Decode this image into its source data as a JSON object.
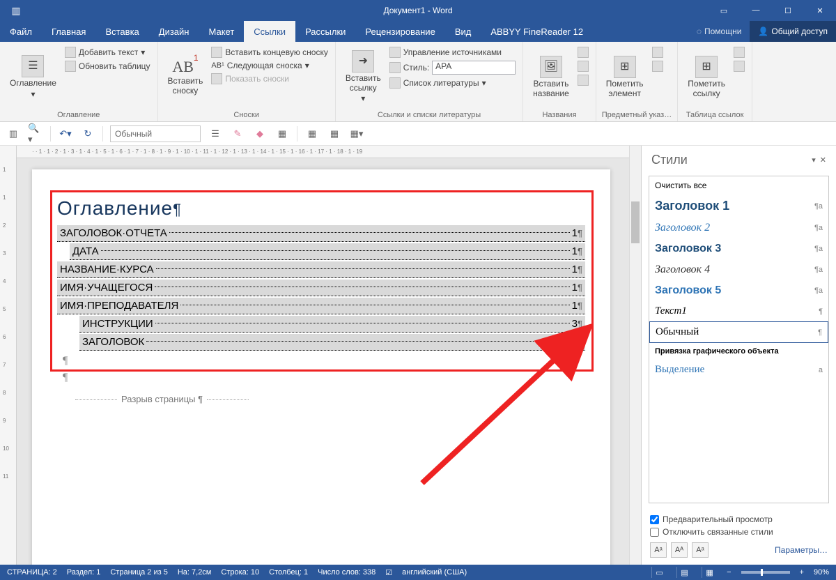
{
  "title": "Документ1 - Word",
  "menu": {
    "file": "Файл",
    "home": "Главная",
    "insert": "Вставка",
    "design": "Дизайн",
    "layout": "Макет",
    "references": "Ссылки",
    "mailings": "Рассылки",
    "review": "Рецензирование",
    "view": "Вид",
    "addin": "ABBYY FineReader 12",
    "tell": "Помощни",
    "share": "Общий доступ"
  },
  "ribbon": {
    "toc": {
      "title": "Оглавление",
      "main": "Оглавление",
      "add": "Добавить текст",
      "update": "Обновить таблицу"
    },
    "footnotes": {
      "title": "Сноски",
      "insert": "Вставить\nсноску",
      "endnote": "Вставить концевую сноску",
      "next": "Следующая сноска",
      "show": "Показать сноски"
    },
    "citations": {
      "title": "Ссылки и списки литературы",
      "insert": "Вставить\nссылку",
      "manage": "Управление источниками",
      "style_label": "Стиль:",
      "style_value": "APA",
      "biblio": "Список литературы"
    },
    "captions": {
      "title": "Названия",
      "insert": "Вставить\nназвание"
    },
    "index": {
      "title": "Предметный указ…",
      "mark": "Пометить\nэлемент"
    },
    "authorities": {
      "title": "Таблица ссылок",
      "mark": "Пометить\nссылку"
    }
  },
  "quick_style": "Обычный",
  "document": {
    "toc_title": "Оглавление",
    "entries": [
      {
        "label": "ЗАГОЛОВОК·ОТЧЕТА",
        "page": "1",
        "indent": 0
      },
      {
        "label": "ДАТА",
        "page": "1",
        "indent": 1
      },
      {
        "label": "НАЗВАНИЕ·КУРСА",
        "page": "1",
        "indent": 0
      },
      {
        "label": "ИМЯ·УЧАЩЕГОСЯ",
        "page": "1",
        "indent": 0
      },
      {
        "label": "ИМЯ·ПРЕПОДАВАТЕЛЯ",
        "page": "1",
        "indent": 0
      },
      {
        "label": "ИНСТРУКЦИИ",
        "page": "3",
        "indent": 2
      },
      {
        "label": "ЗАГОЛОВОК",
        "page": "4",
        "indent": 2
      }
    ],
    "page_break": "Разрыв страницы"
  },
  "styles_pane": {
    "title": "Стили",
    "clear": "Очистить все",
    "items": [
      {
        "name": "Заголовок 1",
        "cls": "h1s",
        "sym": "¶a"
      },
      {
        "name": "Заголовок 2",
        "cls": "h2s",
        "sym": "¶a"
      },
      {
        "name": "Заголовок 3",
        "cls": "h3s",
        "sym": "¶a"
      },
      {
        "name": "Заголовок 4",
        "cls": "h4s",
        "sym": "¶a"
      },
      {
        "name": "Заголовок 5",
        "cls": "h5s",
        "sym": "¶a"
      },
      {
        "name": "Текст1",
        "cls": "txts",
        "sym": "¶"
      },
      {
        "name": "Обычный",
        "cls": "norms",
        "sym": "¶",
        "selected": true
      },
      {
        "name": "Привязка графического объекта",
        "cls": "anchs",
        "sym": ""
      },
      {
        "name": "Выделение",
        "cls": "sels",
        "sym": "a"
      }
    ],
    "preview": "Предварительный просмотр",
    "linked": "Отключить связанные стили",
    "params": "Параметры…"
  },
  "status": {
    "page": "СТРАНИЦА: 2",
    "section": "Раздел: 1",
    "page_of": "Страница 2 из 5",
    "at": "На: 7,2см",
    "line": "Строка: 10",
    "col": "Столбец: 1",
    "words": "Число слов: 338",
    "lang": "английский (США)",
    "zoom": "90%"
  }
}
